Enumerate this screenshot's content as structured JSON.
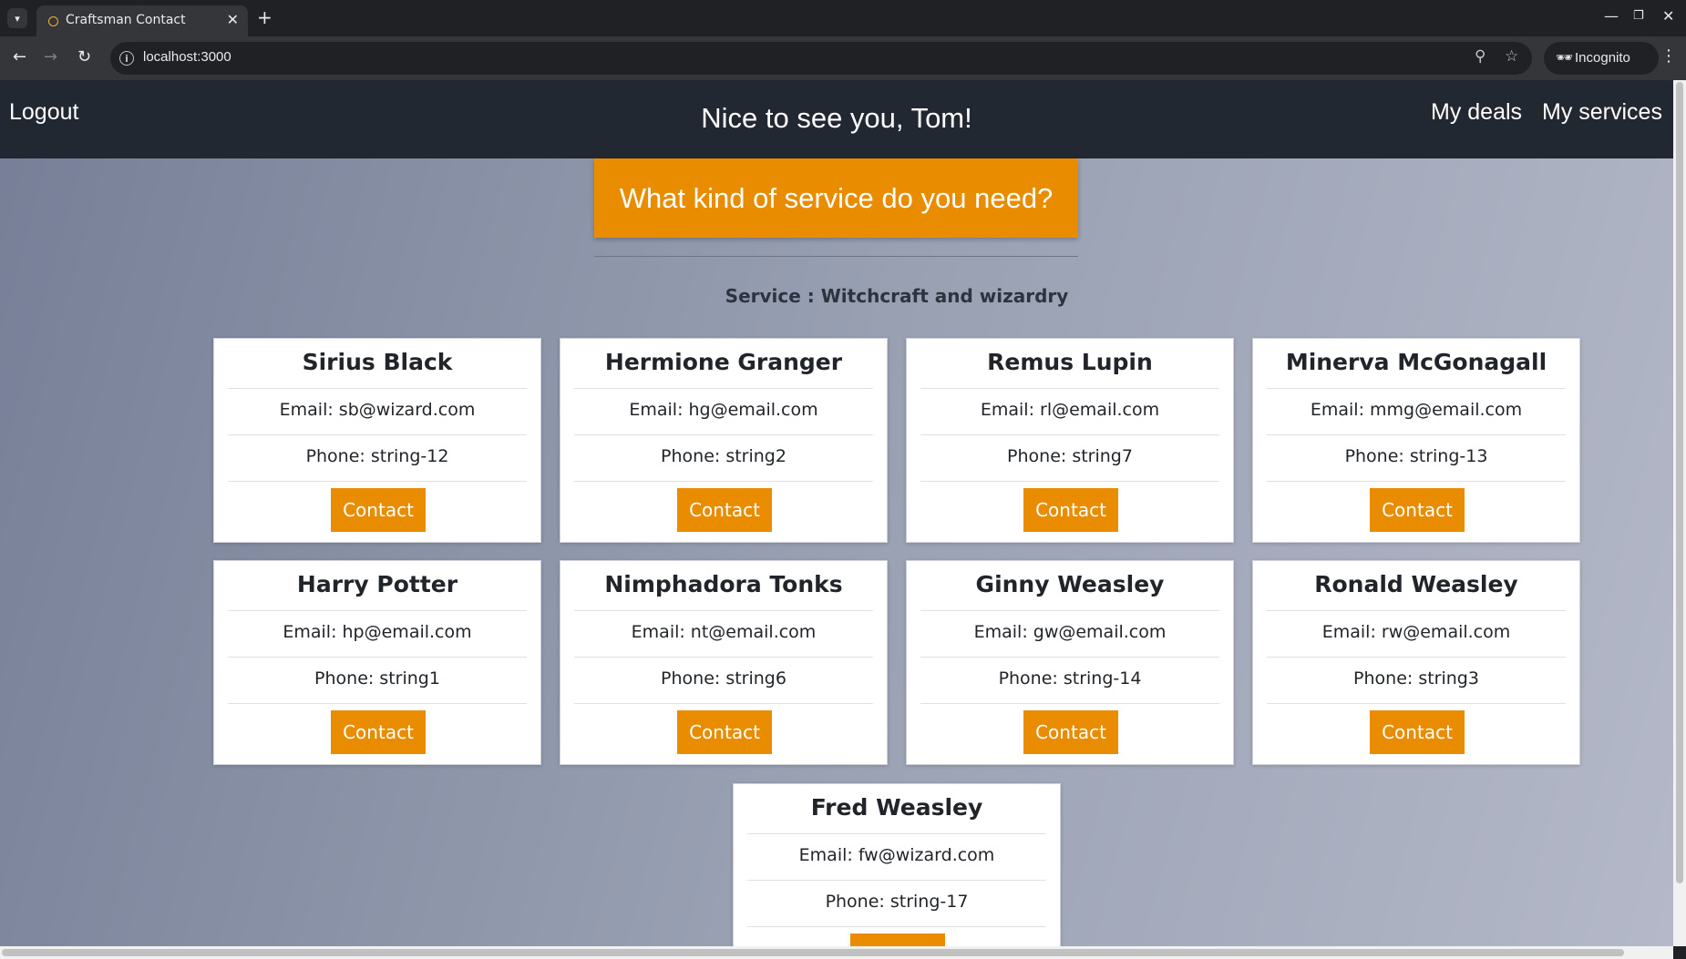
{
  "browser": {
    "tab_title": "Craftsman Contact",
    "url": "localhost:3000",
    "incognito_label": "Incognito"
  },
  "header": {
    "logout": "Logout",
    "greeting": "Nice to see you, Tom!",
    "my_deals": "My deals",
    "my_services": "My services"
  },
  "banner": {
    "question": "What kind of service do you need?"
  },
  "service": {
    "label": "Service :",
    "name": "Witchcraft and wizardry"
  },
  "contact_label": "Contact",
  "craftsmen": [
    {
      "name": "Sirius Black",
      "email": "Email: sb@wizard.com",
      "phone": "Phone: string-12"
    },
    {
      "name": "Hermione Granger",
      "email": "Email: hg@email.com",
      "phone": "Phone: string2"
    },
    {
      "name": "Remus Lupin",
      "email": "Email: rl@email.com",
      "phone": "Phone: string7"
    },
    {
      "name": "Minerva McGonagall",
      "email": "Email: mmg@email.com",
      "phone": "Phone: string-13"
    },
    {
      "name": "Harry Potter",
      "email": "Email: hp@email.com",
      "phone": "Phone: string1"
    },
    {
      "name": "Nimphadora Tonks",
      "email": "Email: nt@email.com",
      "phone": "Phone: string6"
    },
    {
      "name": "Ginny Weasley",
      "email": "Email: gw@email.com",
      "phone": "Phone: string-14"
    },
    {
      "name": "Ronald Weasley",
      "email": "Email: rw@email.com",
      "phone": "Phone: string3"
    },
    {
      "name": "Fred Weasley",
      "email": "Email: fw@wizard.com",
      "phone": "Phone: string-17"
    }
  ],
  "colors": {
    "accent": "#e98c00",
    "header_bg": "#222832"
  }
}
